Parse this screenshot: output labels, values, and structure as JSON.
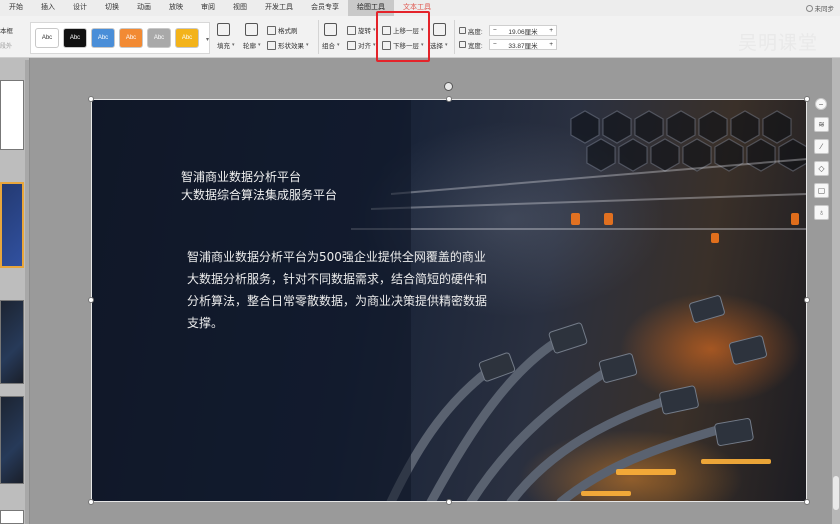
{
  "menu": {
    "items": [
      "开始",
      "插入",
      "设计",
      "切换",
      "动画",
      "放映",
      "审阅",
      "视图",
      "开发工具",
      "会员专享",
      "绘图工具",
      "文本工具"
    ],
    "active": "绘图工具",
    "sync": "未同步"
  },
  "ribbon": {
    "left_stub": "本框",
    "left_stub2": "段外",
    "styles": [
      {
        "label": "Abc",
        "bg": "#ffffff",
        "fg": "#333333"
      },
      {
        "label": "Abc",
        "bg": "#111111",
        "fg": "#ffffff"
      },
      {
        "label": "Abc",
        "bg": "#4a8ed8",
        "fg": "#ffffff"
      },
      {
        "label": "Abc",
        "bg": "#f28a33",
        "fg": "#ffffff"
      },
      {
        "label": "Abc",
        "bg": "#a9a9a9",
        "fg": "#ffffff"
      },
      {
        "label": "Abc",
        "bg": "#f3b31a",
        "fg": "#ffffff"
      }
    ],
    "fill": "填充",
    "outline": "轮廓",
    "format_painter": "格式刷",
    "shape_effects": "形状效果",
    "group": "组合",
    "rotate": "旋转",
    "align": "对齐",
    "bring_forward": "上移一层",
    "send_backward": "下移一层",
    "select": "选择",
    "height_label": "高度:",
    "height_value": "19.06厘米",
    "width_label": "宽度:",
    "width_value": "33.87厘米"
  },
  "watermark": "吴明课堂",
  "slide": {
    "title_line1": "智浦商业数据分析平台",
    "title_line2": "大数据综合算法集成服务平台",
    "body": "智浦商业数据分析平台为500强企业提供全网覆盖的商业大数据分析服务，针对不同数据需求，结合简短的硬件和分析算法，整合日常零散数据，为商业决策提供精密数据支撑。"
  },
  "colors": {
    "highlight": "#e4232a",
    "accent_menu": "#e0574f"
  },
  "float_icons": [
    "minus-icon",
    "layers-icon",
    "brush-icon",
    "fill-icon",
    "frame-icon",
    "bulb-icon"
  ]
}
